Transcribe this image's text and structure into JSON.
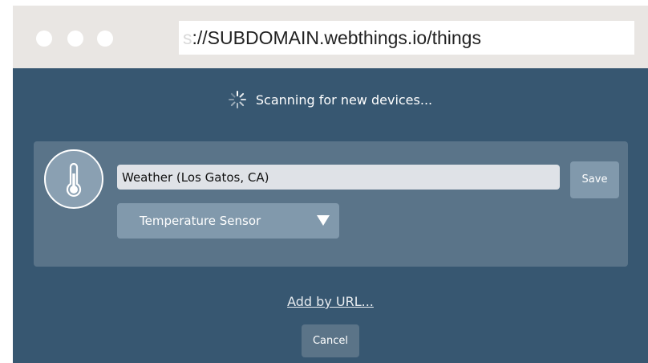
{
  "browser": {
    "url_faded_prefix": "s",
    "url_text": "://SUBDOMAIN.webthings.io/things"
  },
  "scan": {
    "status": "Scanning for new devices...",
    "icon": "spinner-icon"
  },
  "device": {
    "icon": "thermometer-icon",
    "name_value": "Weather (Los Gatos, CA)",
    "save_label": "Save",
    "type_selected": "Temperature Sensor"
  },
  "footer": {
    "add_by_url": "Add by URL...",
    "cancel_label": "Cancel"
  },
  "colors": {
    "background": "#375771",
    "card": "#5a7489",
    "button": "#8199ac",
    "chrome": "#e9e6e3"
  }
}
